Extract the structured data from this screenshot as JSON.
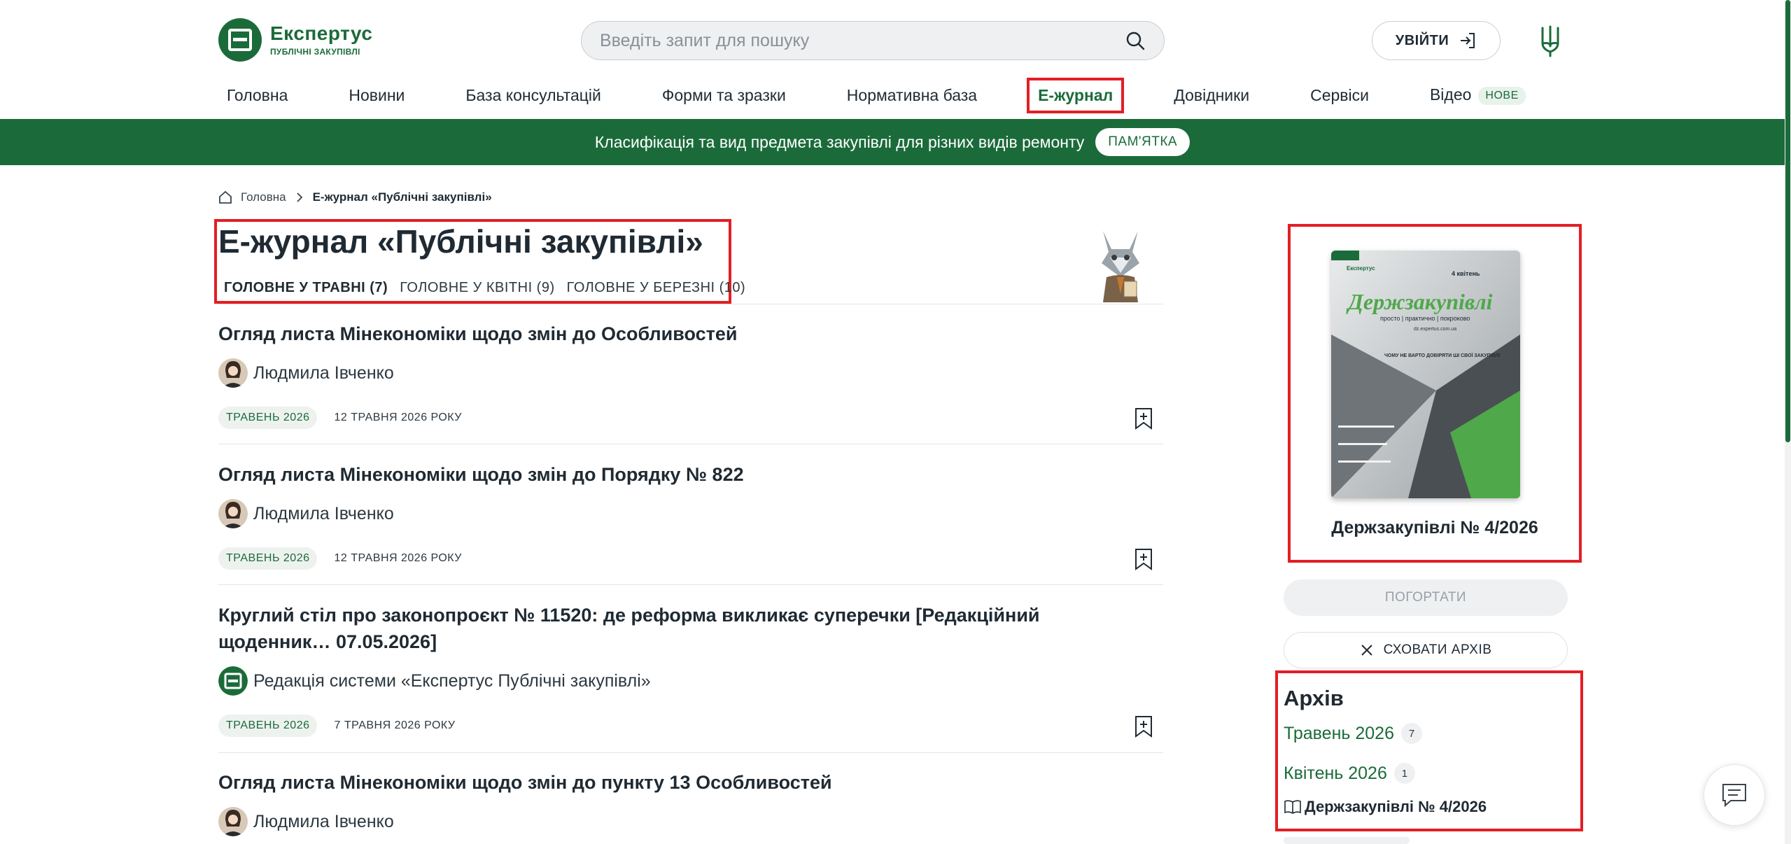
{
  "header": {
    "logo_name": "Експертус",
    "logo_sub": "ПУБЛІЧНІ ЗАКУПІВЛІ",
    "search_placeholder": "Введіть запит для пошуку",
    "login_label": "УВІЙТИ"
  },
  "nav": {
    "items": [
      "Головна",
      "Новини",
      "База консультацій",
      "Форми та зразки",
      "Нормативна база",
      "Е-журнал",
      "Довідники",
      "Сервіси",
      "Відео"
    ],
    "active": "Е-журнал",
    "video_badge": "НОВЕ"
  },
  "banner": {
    "text": "Класифікація та вид предмета закупівлі для різних видів ремонту",
    "button": "ПАМ'ЯТКА"
  },
  "breadcrumb": {
    "home": "Головна",
    "current": "Е-журнал «Публічні закупівлі»"
  },
  "page": {
    "title": "Е-журнал «Публічні закупівлі»",
    "tabs": [
      "ГОЛОВНЕ У ТРАВНІ (7)",
      "ГОЛОВНЕ У КВІТНІ (9)",
      "ГОЛОВНЕ У БЕРЕЗНІ (10)"
    ]
  },
  "articles": [
    {
      "title": "Огляд листа Мінекономіки щодо змін до Особливостей",
      "author": "Людмила Івченко",
      "tag": "ТРАВЕНЬ 2026",
      "date": "12 ТРАВНЯ 2026 РОКУ"
    },
    {
      "title": "Огляд листа Мінекономіки щодо змін до Порядку № 822",
      "author": "Людмила Івченко",
      "tag": "ТРАВЕНЬ 2026",
      "date": "12 ТРАВНЯ 2026 РОКУ"
    },
    {
      "title": "Круглий стіл про законопроєкт № 11520: де реформа викликає суперечки [Редакційний щоденник… 07.05.2026]",
      "author": "Редакція системи «Експертус Публічні закупівлі»",
      "tag": "ТРАВЕНЬ 2026",
      "date": "7 ТРАВНЯ 2026 РОКУ"
    },
    {
      "title": "Огляд листа Мінекономіки щодо змін до пункту 13 Особливостей",
      "author": "Людмила Івченко"
    }
  ],
  "sidebar": {
    "cover_brand": "Експертус",
    "cover_issue_label": "4 квітень",
    "cover_title": "Держзакупівлі",
    "cover_tagline": "просто | практично | покроково",
    "cover_site": "dz.expertus.com.ua",
    "cover_headline": "ЧОМУ НЕ ВАРТО ДОВІРЯТИ ШІ СВОЇ ЗАКУПІВЛІ",
    "caption": "Держзакупівлі № 4/2026",
    "flip_button": "ПОГОРТАТИ",
    "hide_button": "СХОВАТИ АРХІВ",
    "archive_title": "Архів",
    "archive": [
      {
        "label": "Травень 2026",
        "count": "7"
      },
      {
        "label": "Квітень 2026",
        "count": "1"
      }
    ],
    "archive_issue": "Держзакупівлі № 4/2026"
  },
  "colors": {
    "brand_green": "#1b6b3a",
    "highlight_red": "#e31e24"
  }
}
